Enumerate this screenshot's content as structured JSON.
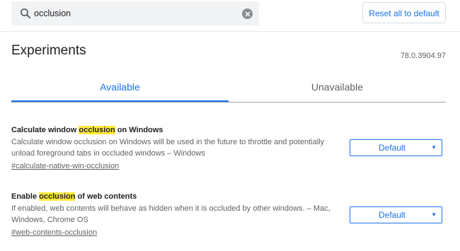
{
  "search": {
    "value": "occlusion",
    "icon": "search-icon",
    "clear_icon": "close-icon"
  },
  "header": {
    "reset_label": "Reset all to default"
  },
  "page": {
    "title": "Experiments",
    "version": "78.0.3904.97"
  },
  "tabs": [
    {
      "label": "Available",
      "active": true
    },
    {
      "label": "Unavailable",
      "active": false
    }
  ],
  "experiments": [
    {
      "title_before": "Calculate window ",
      "title_highlight": "occlusion",
      "title_after": " on Windows",
      "description": "Calculate window occlusion on Windows will be used in the future to throttle and potentially unload foreground tabs in occluded windows – Windows",
      "link": "#calculate-native-win-occlusion",
      "selected": "Default"
    },
    {
      "title_before": "Enable ",
      "title_highlight": "occlusion",
      "title_after": " of web contents",
      "description": "If enabled, web contents will behave as hidden when it is occluded by other windows. – Mac, Windows, Chrome OS",
      "link": "#web-contents-occlusion",
      "selected": "Default"
    }
  ],
  "colors": {
    "accent": "#1a73e8",
    "highlight": "#ffeb3b",
    "search_bg": "#f1f3f4"
  }
}
